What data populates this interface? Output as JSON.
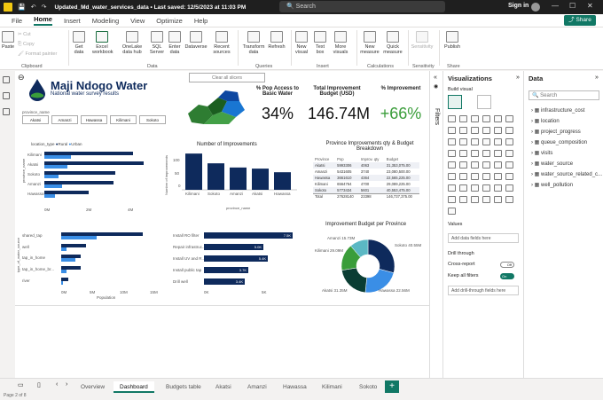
{
  "titlebar": {
    "filename": "Updated_Md_water_services_data • Last saved: 12/5/2023 at 11:03 PM",
    "search": "Search",
    "signin": "Sign in"
  },
  "tabs": [
    "File",
    "Home",
    "Insert",
    "Modeling",
    "View",
    "Optimize",
    "Help"
  ],
  "share": "Share",
  "ribbon": {
    "clipboard": {
      "paste": "Paste",
      "cut": "Cut",
      "copy": "Copy",
      "format_painter": "Format painter",
      "group": "Clipboard"
    },
    "data": {
      "get_data": "Get data",
      "excel": "Excel workbook",
      "onelake": "OneLake data hub",
      "sql": "SQL Server",
      "enter": "Enter data",
      "dataverse": "Dataverse",
      "recent": "Recent sources",
      "group": "Data"
    },
    "queries": {
      "transform": "Transform data",
      "refresh": "Refresh",
      "group": "Queries"
    },
    "insert": {
      "new_visual": "New visual",
      "text_box": "Text box",
      "more_visuals": "More visuals",
      "group": "Insert"
    },
    "calculations": {
      "new_measure": "New measure",
      "quick_measure": "Quick measure",
      "group": "Calculations"
    },
    "sensitivity": {
      "label": "Sensitivity",
      "group": "Sensitivity"
    },
    "share": {
      "publish": "Publish",
      "group": "Share"
    }
  },
  "report": {
    "title": "Maji Ndogo Water",
    "subtitle": "National water survey results",
    "clear_filters": "Clear all slicers",
    "slicer_label": "province_name",
    "provinces": [
      "Akatsi",
      "Amanzi",
      "Hawassa",
      "Kilimani",
      "Sokoto"
    ],
    "kpis": [
      {
        "title": "% Pop Access to Basic Water",
        "value": "34%"
      },
      {
        "title": "Total Improvement Budget (USD)",
        "value": "146.74M"
      },
      {
        "title": "% Improvement",
        "value": "+66%"
      }
    ],
    "location_legend": {
      "title": "location_type",
      "rural": "Rural",
      "urban": "Urban"
    },
    "province_axis": "province_name",
    "province_rows": [
      "Kilimani",
      "Akatsi",
      "Sokoto",
      "Amanzi",
      "Hawassa"
    ],
    "province_ticks": [
      "0M",
      "2M",
      "4M"
    ],
    "source_axis": "type_of_water_source",
    "source_rows": [
      "shared_tap",
      "well",
      "tap_in_home",
      "tap_in_home_br...",
      "river"
    ],
    "source_ticks": [
      "0M",
      "5M",
      "10M",
      "15M"
    ],
    "source_xlabel": "Population",
    "improvements_title": "Number of Improvements",
    "improvements_ylabel": "Number of improvements",
    "improvements_xlabel": "province_name",
    "improvements_yticks": [
      "100",
      "50",
      "0"
    ],
    "improvement_types": [
      {
        "label": "Install RO filter",
        "value": "7.5K"
      },
      {
        "label": "Repair infrastruc...",
        "value": "5.0K"
      },
      {
        "label": "Install UV and R...",
        "value": "5.4K"
      },
      {
        "label": "Install public tap",
        "value": "3.7K"
      },
      {
        "label": "Drill well",
        "value": "3.4K"
      }
    ],
    "improvement_ticks": [
      "0K",
      "5K"
    ],
    "table_title": "Province Improvements qty & Budget Breakdown",
    "table_headers": [
      "Province",
      "Pop",
      "Improv. qty",
      "Budget"
    ],
    "table_rows": [
      [
        "Akatsi",
        "5993306",
        "4063",
        "31,353,075.00"
      ],
      [
        "Amanzi",
        "5431605",
        "3740",
        "23,080,500.00"
      ],
      [
        "Hawassa",
        "3661610",
        "4364",
        "22,565,225.00"
      ],
      [
        "Kilimani",
        "6564764",
        "4700",
        "29,089,225.00"
      ],
      [
        "Sokoto",
        "5773434",
        "5601",
        "40,553,475.00"
      ],
      [
        "Total",
        "27628140",
        "23398",
        "146,737,375.00"
      ]
    ],
    "donut_title": "Improvement Budget per Province",
    "donut_labels": [
      "Amanzi 15.73M",
      "Sokoto 40.55M",
      "Kilimani 29.09M",
      "Akatsi 31.35M",
      "Hawassa 22.56M"
    ]
  },
  "chart_data": [
    {
      "type": "bar",
      "title": "Number of Improvements",
      "categories": [
        "Kilimani",
        "Sokoto",
        "Amanzi",
        "Akatsi",
        "Hawassa"
      ],
      "values": [
        130,
        95,
        80,
        76,
        63
      ],
      "ylim": [
        0,
        140
      ],
      "ylabel": "Number of improvements",
      "xlabel": "province_name"
    },
    {
      "type": "pie",
      "title": "Improvement Budget per Province",
      "categories": [
        "Sokoto",
        "Akatsi",
        "Kilimani",
        "Hawassa",
        "Amanzi"
      ],
      "values": [
        40.55,
        31.35,
        29.09,
        22.56,
        15.73
      ]
    }
  ],
  "filters_label": "Filters",
  "viz": {
    "title": "Visualizations",
    "build": "Build visual",
    "values": "Values",
    "add_fields": "Add data fields here",
    "drill": "Drill through",
    "cross": "Cross-report",
    "cross_state": "Off",
    "keep": "Keep all filters",
    "keep_state": "On",
    "add_drill": "Add drill-through fields here"
  },
  "data": {
    "title": "Data",
    "search": "Search",
    "items": [
      "infrastructure_cost",
      "location",
      "project_progress",
      "queue_composition",
      "visits",
      "water_source",
      "water_source_related_c...",
      "well_pollution"
    ]
  },
  "pages": [
    "Overview",
    "Dashboard",
    "Budgets table",
    "Akatsi",
    "Amanzi",
    "Hawassa",
    "Kilimani",
    "Sokoto"
  ],
  "status": "Page 2 of 8"
}
